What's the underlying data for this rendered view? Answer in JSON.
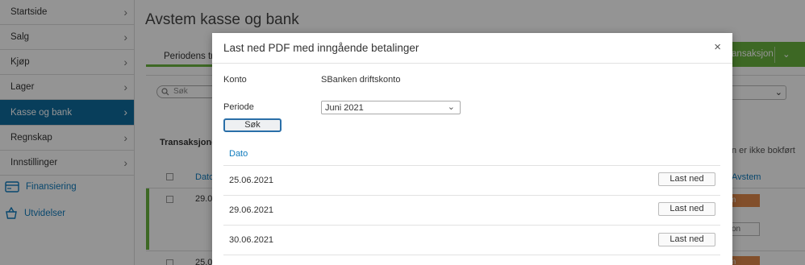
{
  "sidebar": {
    "items": [
      {
        "label": "Startside"
      },
      {
        "label": "Salg"
      },
      {
        "label": "Kjøp"
      },
      {
        "label": "Lager"
      },
      {
        "label": "Kasse og bank"
      },
      {
        "label": "Regnskap"
      },
      {
        "label": "Innstillinger"
      }
    ],
    "links": [
      {
        "label": "Finansiering",
        "icon": "card-icon"
      },
      {
        "label": "Utvidelser",
        "icon": "basket-icon"
      }
    ],
    "active_color": "#0f6b9e",
    "link_color": "#0f7bbd"
  },
  "main": {
    "title": "Avstem kasse og bank",
    "tab_label": "Periodens transaksjoner",
    "action_button_label": "transaksjon",
    "search_placeholder": "Søk",
    "transactions_title": "Transaksjoner",
    "bokfort_text": "n er ikke bokført",
    "col_dato": "Dato",
    "col_avstem": "Avstem",
    "row_dates": [
      "29.06",
      "25.06"
    ],
    "orange_btn_text": "m",
    "grey_btn_text": "on",
    "accent_color": "#6ab43e"
  },
  "modal": {
    "title": "Last ned PDF med inngående betalinger",
    "close_symbol": "×",
    "konto_label": "Konto",
    "konto_value": "SBanken driftskonto",
    "periode_label": "Periode",
    "periode_value": "Juni 2021",
    "sok_label": "Søk",
    "dato_header": "Dato",
    "rows": [
      {
        "date": "25.06.2021",
        "button": "Last ned"
      },
      {
        "date": "29.06.2021",
        "button": "Last ned"
      },
      {
        "date": "30.06.2021",
        "button": "Last ned"
      }
    ]
  }
}
